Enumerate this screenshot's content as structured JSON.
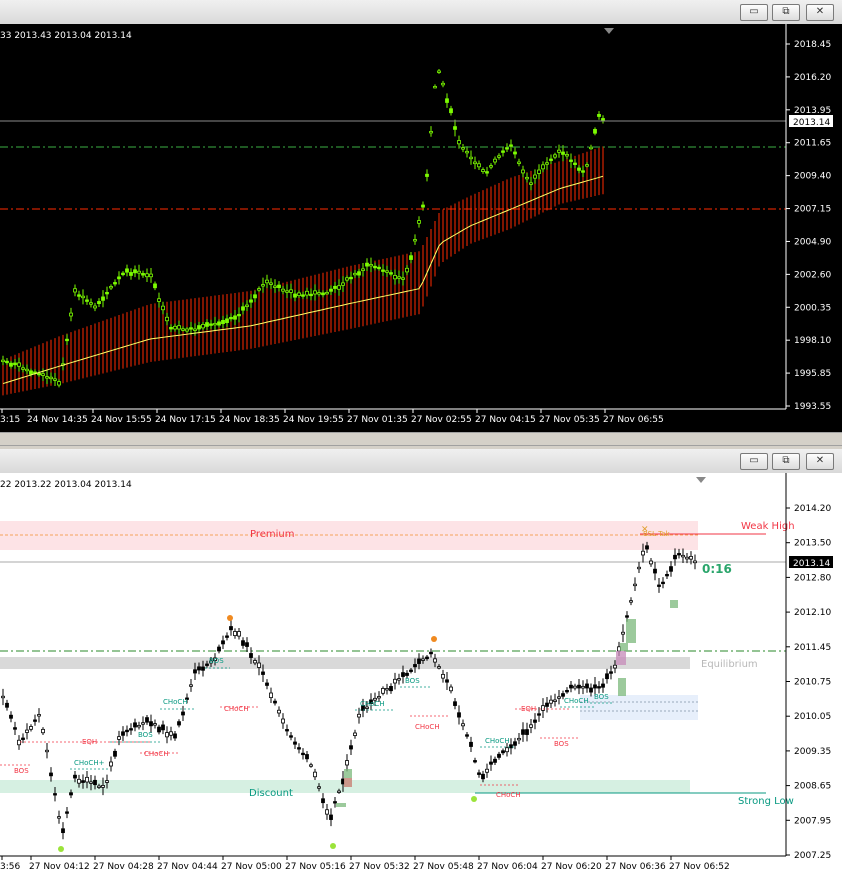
{
  "top_window": {
    "ohlc_text": "33 2013.43 2013.04 2013.14",
    "price_badge": "2013.14",
    "y_ticks": [
      "2018.45",
      "2016.20",
      "2013.95",
      "2011.65",
      "2009.40",
      "2007.15",
      "2004.90",
      "2002.60",
      "2000.35",
      "1998.10",
      "1995.85",
      "1993.55"
    ],
    "x_ticks": [
      "3:15",
      "24 Nov 14:35",
      "24 Nov 15:55",
      "24 Nov 17:15",
      "24 Nov 18:35",
      "24 Nov 19:55",
      "27 Nov 01:35",
      "27 Nov 02:55",
      "27 Nov 04:15",
      "27 Nov 05:35",
      "27 Nov 06:55"
    ],
    "colors": {
      "background": "#000000",
      "bull_candle": "#7cfc00",
      "band": "#ff2a00",
      "midline": "#ffff66",
      "hline_green": "#3cb043",
      "hline_red": "#ff2a00"
    }
  },
  "bottom_window": {
    "ohlc_text": "22 2013.22 2013.04 2013.14",
    "price_badge": "2013.14",
    "timer": "0:16",
    "y_ticks": [
      "2014.20",
      "2013.50",
      "2012.80",
      "2012.10",
      "2011.45",
      "2010.75",
      "2010.05",
      "2009.35",
      "2008.65",
      "2007.95",
      "2007.25"
    ],
    "x_ticks": [
      "3:56",
      "27 Nov 04:12",
      "27 Nov 04:28",
      "27 Nov 04:44",
      "27 Nov 05:00",
      "27 Nov 05:16",
      "27 Nov 05:32",
      "27 Nov 05:48",
      "27 Nov 06:04",
      "27 Nov 06:20",
      "27 Nov 06:36",
      "27 Nov 06:52"
    ],
    "zones": {
      "premium": "Premium",
      "equilibrium": "Equilibrium",
      "discount": "Discount",
      "weak_high": "Weak High",
      "strong_low": "Strong Low",
      "bsl": "BSL Tak"
    },
    "labels": {
      "bos": "BOS",
      "choch": "CHoCH",
      "choch_plus": "CHoCH+",
      "eqh": "EQH"
    },
    "colors": {
      "background": "#ffffff",
      "candle": "#000000",
      "bull_label": "#089981",
      "bear_label": "#f23645",
      "premium_zone": "#fde3e6",
      "discount_zone": "#d6f0e2",
      "equilibrium_zone": "#d6d6d6"
    }
  },
  "window_buttons": {
    "minimize": "▭",
    "restore": "⧉",
    "close": "✕"
  }
}
